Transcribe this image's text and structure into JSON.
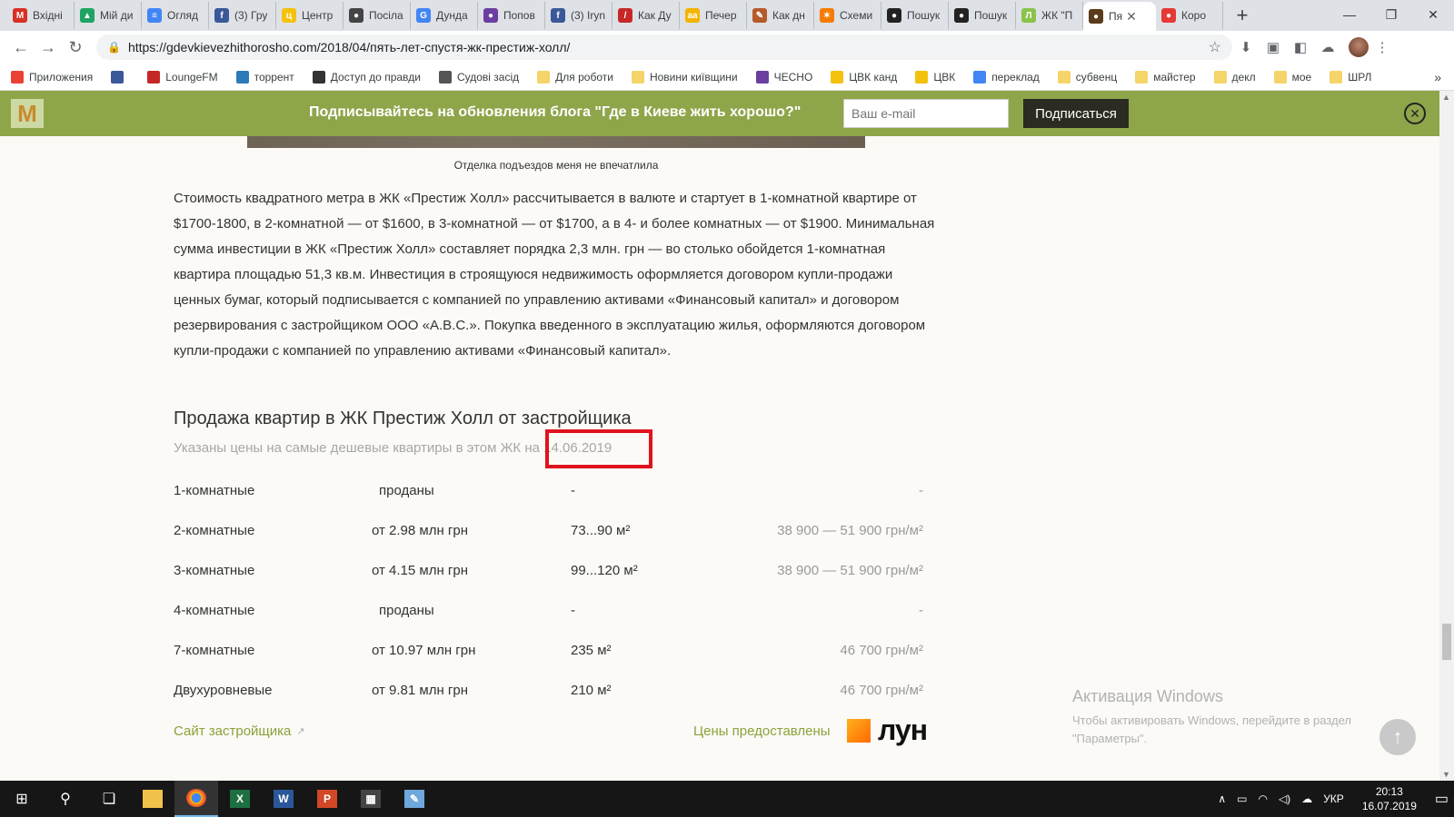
{
  "browser": {
    "tabs": [
      {
        "label": "Вхідні",
        "icon": "gmail-icon",
        "color": "#d93025",
        "glyph": "M"
      },
      {
        "label": "Мій ди",
        "icon": "drive-icon",
        "color": "#1fa463",
        "glyph": "▲"
      },
      {
        "label": "Огляд",
        "icon": "docs-icon",
        "color": "#4285f4",
        "glyph": "≡"
      },
      {
        "label": "(3) Гру",
        "icon": "facebook-icon",
        "color": "#3b5998",
        "glyph": "f"
      },
      {
        "label": "Центр",
        "icon": "cvk-icon",
        "color": "#f4c20d",
        "glyph": "ц"
      },
      {
        "label": "Посіла",
        "icon": "bag-icon",
        "color": "#444444",
        "glyph": "●"
      },
      {
        "label": "Дунда",
        "icon": "google-icon",
        "color": "#4285f4",
        "glyph": "G"
      },
      {
        "label": "Попов",
        "icon": "circle-icon",
        "color": "#6a3fa0",
        "glyph": "●"
      },
      {
        "label": "(3) Iryn",
        "icon": "facebook-icon",
        "color": "#3b5998",
        "glyph": "f"
      },
      {
        "label": "Как Ду",
        "icon": "pen-icon",
        "color": "#c62828",
        "glyph": "/"
      },
      {
        "label": "Печер",
        "icon": "aa-icon",
        "color": "#f4b400",
        "glyph": "aa"
      },
      {
        "label": "Как дн",
        "icon": "paint-icon",
        "color": "#b55a2a",
        "glyph": "✎"
      },
      {
        "label": "Схеми",
        "icon": "star-icon",
        "color": "#f57c00",
        "glyph": "✶"
      },
      {
        "label": "Пошук",
        "icon": "tor-icon",
        "color": "#222222",
        "glyph": "●"
      },
      {
        "label": "Пошук",
        "icon": "tor-icon",
        "color": "#222222",
        "glyph": "●"
      },
      {
        "label": "ЖК \"П",
        "icon": "lun-tab-icon",
        "color": "#8bc34a",
        "glyph": "Л"
      },
      {
        "label": "Пя",
        "icon": "site-icon",
        "color": "#5a3b1a",
        "glyph": "●",
        "active": true
      },
      {
        "label": "Коро",
        "icon": "youtube-icon",
        "color": "#e53935",
        "glyph": "●"
      }
    ],
    "url": "https://gdevkievezhithorosho.com/2018/04/пять-лет-спустя-жк-престиж-холл/",
    "bookmarks": [
      {
        "label": "Приложения",
        "icon": "apps-icon",
        "color": "#e94235"
      },
      {
        "label": "",
        "icon": "facebook-icon",
        "color": "#3b5998"
      },
      {
        "label": "LoungeFM",
        "icon": "loungefm-icon",
        "color": "#c62828"
      },
      {
        "label": "торрент",
        "icon": "torrent-icon",
        "color": "#2b7bb9"
      },
      {
        "label": "Доступ до правди",
        "icon": "question-icon",
        "color": "#333333"
      },
      {
        "label": "Судові засід",
        "icon": "globe-icon",
        "color": "#555555"
      },
      {
        "label": "Для роботи",
        "icon": "folder-icon",
        "color": "#f5d46a"
      },
      {
        "label": "Новини київщини",
        "icon": "folder-icon",
        "color": "#f5d46a"
      },
      {
        "label": "ЧЕСНО",
        "icon": "chesno-icon",
        "color": "#6a3fa0"
      },
      {
        "label": "ЦВК канд",
        "icon": "cvk-icon",
        "color": "#f4c20d"
      },
      {
        "label": "ЦВК",
        "icon": "cvk-icon",
        "color": "#f4c20d"
      },
      {
        "label": "переклад",
        "icon": "google-icon",
        "color": "#4285f4"
      },
      {
        "label": "субвенц",
        "icon": "folder-icon",
        "color": "#f5d46a"
      },
      {
        "label": "майстер",
        "icon": "folder-icon",
        "color": "#f5d46a"
      },
      {
        "label": "декл",
        "icon": "folder-icon",
        "color": "#f5d46a"
      },
      {
        "label": "мое",
        "icon": "folder-icon",
        "color": "#f5d46a"
      },
      {
        "label": "ШРЛ",
        "icon": "folder-icon",
        "color": "#f5d46a"
      }
    ],
    "bookmarks_more": "»"
  },
  "banner": {
    "logo": "M",
    "text": "Подписывайтесь на обновления блога \"Где в Киеве жить хорошо?\"",
    "email_placeholder": "Ваш e-mail",
    "subscribe_label": "Подписаться",
    "close_glyph": "✕"
  },
  "article": {
    "caption": "Отделка подъездов меня не впечатлила",
    "paragraph": "Стоимость квадратного метра в ЖК «Престиж Холл» рассчитывается в валюте и стартует в 1-комнатной квартире от $1700-1800, в 2-комнатной — от $1600, в 3-комнатной — от $1700, а в 4- и более комнатных — от $1900. Минимальная сумма инвестиции в ЖК «Престиж Холл» составляет порядка 2,3 млн. грн — во столько обойдется 1-комнатная квартира площадью  51,3 кв.м. Инвестиция в строящуюся недвижимость оформляется договором купли-продажи ценных бумаг, который подписывается с компанией по управлению активами «Финансовый капитал» и договором резервирования с застройщиком ООО «А.В.С.». Покупка введенного в эксплуатацию жилья, оформляются договором купли-продажи с компанией по управлению активами «Финансовый капитал».",
    "heading": "Продажа квартир в ЖК Престиж Холл от застройщика",
    "subheading": "Указаны цены на самые дешевые квартиры в этом ЖК на 14.06.2019",
    "prices": [
      {
        "type": "1-комнатные",
        "price": "проданы",
        "area": "-",
        "per_m2": "-"
      },
      {
        "type": "2-комнатные",
        "price": "от 2.98 млн грн",
        "area": "73...90 м²",
        "per_m2": "38 900 — 51 900 грн/м²"
      },
      {
        "type": "3-комнатные",
        "price": "от 4.15 млн грн",
        "area": "99...120 м²",
        "per_m2": "38 900 — 51 900 грн/м²"
      },
      {
        "type": "4-комнатные",
        "price": "проданы",
        "area": "-",
        "per_m2": "-"
      },
      {
        "type": "7-комнатные",
        "price": "от 10.97 млн грн",
        "area": "235 м²",
        "per_m2": "46 700 грн/м²"
      },
      {
        "type": "Двухуровневые",
        "price": "от 9.81 млн грн",
        "area": "210 м²",
        "per_m2": "46 700 грн/м²"
      }
    ],
    "developer_link": "Сайт застройщика",
    "prices_provided": "Цены предоставлены",
    "lun_logo": "лун",
    "highlight_color": "#e0121f"
  },
  "windows_activation": {
    "title": "Активация Windows",
    "line1": "Чтобы активировать Windows, перейдите в раздел",
    "line2": "\"Параметры\"."
  },
  "taskbar": {
    "lang": "УКР",
    "time": "20:13",
    "date": "16.07.2019"
  }
}
